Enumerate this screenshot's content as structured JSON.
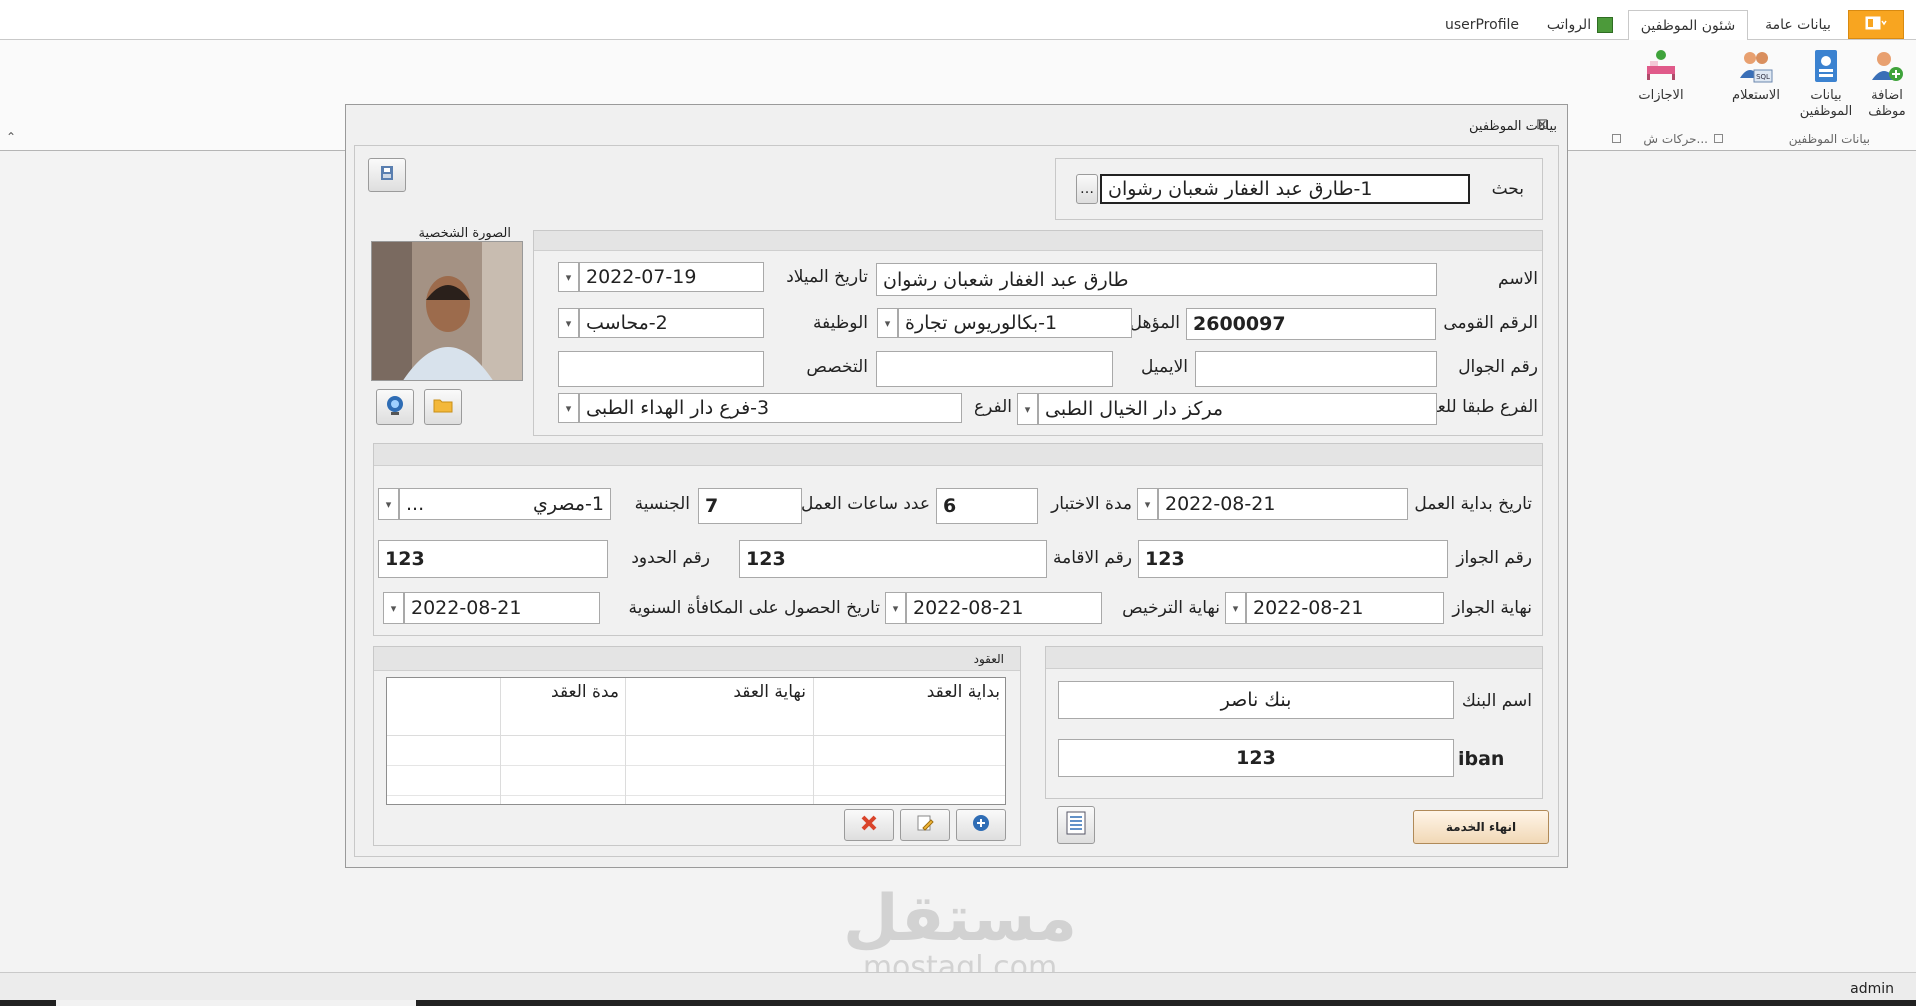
{
  "tabs": {
    "general": "بيانات عامة",
    "employees": "شئون الموظفين",
    "salaries": "الرواتب",
    "profile": "userProfile"
  },
  "ribbon": {
    "add_employee": "اضافة موظف",
    "employee_data": "بيانات الموظفين",
    "query": "الاستعلام",
    "vacations": "الاجازات",
    "group_employee_data": "بيانات الموظفين",
    "group_moves": "حركات ش..."
  },
  "dialog": {
    "title": "بيانات الموظفين",
    "search_label": "بحث",
    "search_value": "1-طارق عبد الغفار شعبان رشوان",
    "photo_label": "الصورة الشخصية"
  },
  "personal": {
    "name_label": "الاسم",
    "name_value": "طارق عبد الغفار شعبان رشوان",
    "birth_label": "تاريخ الميلاد",
    "birth_value": "2022-07-19",
    "national_id_label": "الرقم القومى",
    "national_id_value": "2600097",
    "qualification_label": "المؤهل",
    "qualification_value": "1-بكالوريوس تجارة",
    "job_label": "الوظيفة",
    "job_value": "2-محاسب",
    "mobile_label": "رقم الجوال",
    "mobile_value": "",
    "email_label": "الايميل",
    "email_value": "",
    "specialty_label": "التخصص",
    "specialty_value": "",
    "contract_branch_label": "الفرع طبقا للعقد",
    "contract_branch_value": "مركز دار الخيال الطبى",
    "branch_label": "الفرع",
    "branch_value": "3-فرع دار الهداء الطبى"
  },
  "work": {
    "start_label": "تاريخ بداية العمل",
    "start_value": "2022-08-21",
    "probation_label": "مدة الاختبار",
    "probation_value": "6",
    "hours_label": "عدد ساعات العمل",
    "hours_value": "7",
    "nationality_label": "الجنسية",
    "nationality_value": "1-مصري",
    "nationality_more": "...",
    "passport_label": "رقم الجواز",
    "passport_value": "123",
    "residence_label": "رقم الاقامة",
    "residence_value": "123",
    "border_label": "رقم الحدود",
    "border_value": "123",
    "passport_end_label": "نهاية الجواز",
    "passport_end_value": "2022-08-21",
    "license_end_label": "نهاية الترخيص",
    "license_end_value": "2022-08-21",
    "bonus_date_label": "تاريخ الحصول على المكافأة السنوية",
    "bonus_date_value": "2022-08-21"
  },
  "bank": {
    "bank_name_label": "اسم البنك",
    "bank_name_value": "بنك ناصر",
    "iban_label": "iban",
    "iban_value": "123",
    "end_service_label": "انهاء الخدمة"
  },
  "contracts": {
    "title": "العقود",
    "columns": [
      "بداية العقد",
      "نهاية العقد",
      "مدة العقد"
    ]
  },
  "status": {
    "user": "admin"
  },
  "watermark": {
    "arabic": "مستقل",
    "latin": "mostaql.com"
  },
  "colors": {
    "file_tab": "#f8a520",
    "accent_blue": "#2f6db5"
  }
}
